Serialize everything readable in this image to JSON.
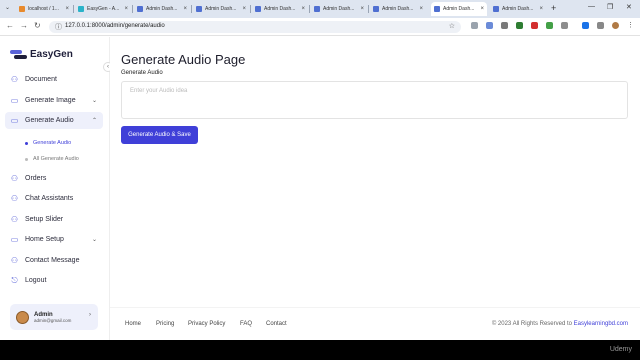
{
  "browser": {
    "tabs": [
      {
        "title": "localhost / 1..."
      },
      {
        "title": "EasyGen - A..."
      },
      {
        "title": "Admin Dash..."
      },
      {
        "title": "Admin Dash..."
      },
      {
        "title": "Admin Dash..."
      },
      {
        "title": "Admin Dash..."
      },
      {
        "title": "Admin Dash..."
      },
      {
        "title": "Admin Dash..."
      },
      {
        "title": "Admin Dash..."
      }
    ],
    "url": "127.0.0.1:8000/admin/generate/audio"
  },
  "sidebar": {
    "brand": "EasyGen",
    "items": [
      {
        "label": "Document",
        "icon": "user-icon"
      },
      {
        "label": "Generate Image",
        "icon": "folder-icon"
      },
      {
        "label": "Generate Audio",
        "icon": "folder-icon"
      },
      {
        "label": "Orders",
        "icon": "user-icon"
      },
      {
        "label": "Chat Assistants",
        "icon": "user-icon"
      },
      {
        "label": "Setup Slider",
        "icon": "user-icon"
      },
      {
        "label": "Home Setup",
        "icon": "folder-icon"
      },
      {
        "label": "Contact Message",
        "icon": "user-icon"
      },
      {
        "label": "Logout",
        "icon": "logout-icon"
      }
    ],
    "subitems": [
      {
        "label": "Generate Audio"
      },
      {
        "label": "All Generate Audio"
      }
    ],
    "profile": {
      "name": "Admin",
      "email": "admin@gmail.com"
    }
  },
  "main": {
    "title": "Generate Audio Page",
    "field_label": "Generate Audio",
    "placeholder": "Enter your Audio idea",
    "button": "Generate Audio & Save"
  },
  "footer": {
    "links": [
      "Home",
      "Pricing",
      "Privacy Policy",
      "FAQ",
      "Contact"
    ],
    "copyright": "© 2023 All Rights Reserved to ",
    "brand": "Easylearningbd.com"
  },
  "overlay": {
    "watermark": "Udemy"
  },
  "colors": {
    "accent": "#3f3fd8",
    "active_bg": "#eef0fb",
    "tabstrip": "#dee5f0"
  }
}
